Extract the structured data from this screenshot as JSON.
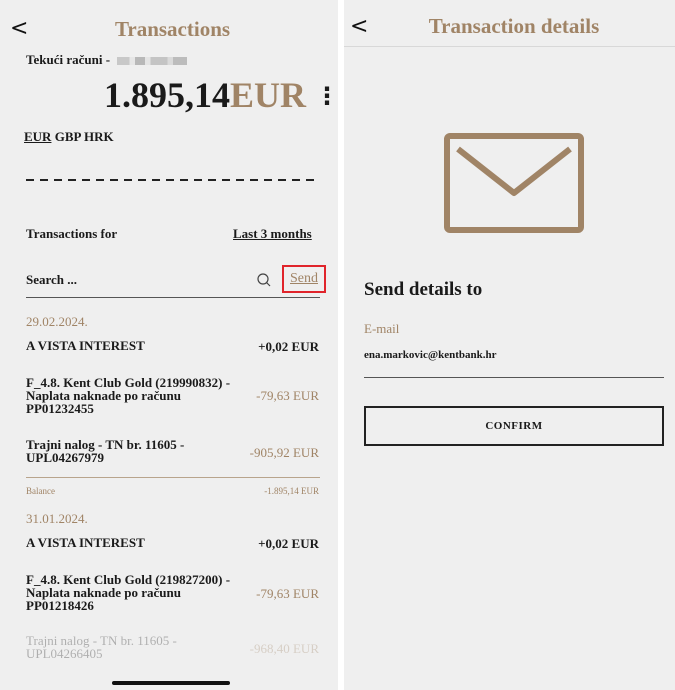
{
  "left": {
    "title": "Transactions",
    "account_label": "Tekući računi -",
    "balance_amount": "1.895,14",
    "balance_currency": "EUR",
    "more_icon": "⋮",
    "currencies": [
      "EUR",
      "GBP",
      "HRK"
    ],
    "transactions_for_label": "Transactions for",
    "period": "Last 3 months",
    "search_placeholder": "Search ...",
    "send_label": "Send",
    "groups": [
      {
        "date": "29.02.2024.",
        "items": [
          {
            "title": "A VISTA INTEREST",
            "amount": "+0,02 EUR"
          },
          {
            "title": "F_4.8. Kent Club Gold (219990832) - Naplata naknade po računu PP01232455",
            "amount": "-79,63 EUR"
          },
          {
            "title": "Trajni nalog - TN br. 11605 - UPL04267979",
            "amount": "-905,92 EUR"
          }
        ],
        "balance_label": "Balance",
        "balance_value": "-1.895,14 EUR"
      },
      {
        "date": "31.01.2024.",
        "items": [
          {
            "title": "A VISTA INTEREST",
            "amount": "+0,02 EUR"
          },
          {
            "title": "F_4.8. Kent Club Gold (219827200) - Naplata naknade po računu PP01218426",
            "amount": "-79,63 EUR"
          },
          {
            "title": "Trajni nalog - TN br. 11605 - UPL04266405",
            "amount": "-968,40 EUR"
          }
        ]
      }
    ]
  },
  "right": {
    "title": "Transaction details",
    "send_details_title": "Send details to",
    "email_label": "E-mail",
    "email_value": "ena.markovic@kentbank.hr",
    "confirm_label": "CONFIRM"
  },
  "icons": {
    "back": "<",
    "search": "search-icon",
    "envelope": "envelope-icon",
    "more": "more-vertical-icon"
  },
  "colors": {
    "accent": "#a08466",
    "background": "#efefef",
    "highlight": "#e0242b"
  }
}
